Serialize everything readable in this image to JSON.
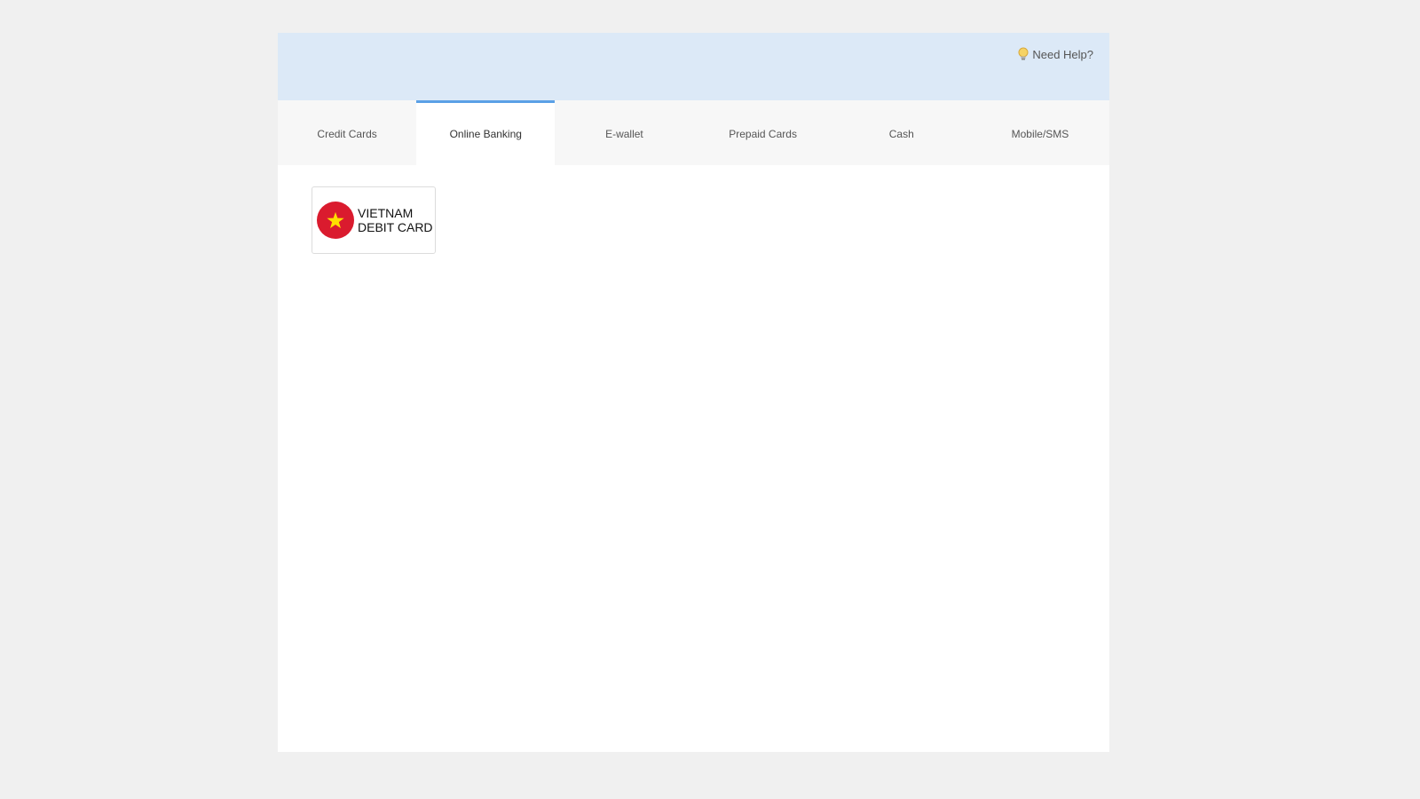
{
  "header": {
    "help_label": "Need Help?",
    "help_icon": "lightbulb-icon"
  },
  "tabs": [
    {
      "label": "Credit Cards",
      "active": false
    },
    {
      "label": "Online Banking",
      "active": true
    },
    {
      "label": "E-wallet",
      "active": false
    },
    {
      "label": "Prepaid Cards",
      "active": false
    },
    {
      "label": "Cash",
      "active": false
    },
    {
      "label": "Mobile/SMS",
      "active": false
    }
  ],
  "methods": [
    {
      "line1": "VIETNAM",
      "line2": "DEBIT CARD",
      "icon": "vietnam-flag-icon"
    }
  ],
  "colors": {
    "background": "#f0f0f0",
    "header_bg": "#dce9f7",
    "tab_bar_bg": "#f7f7f7",
    "active_tab_accent": "#5aa0e6",
    "flag_red": "#da1b2e",
    "flag_star": "#ffdf00"
  }
}
